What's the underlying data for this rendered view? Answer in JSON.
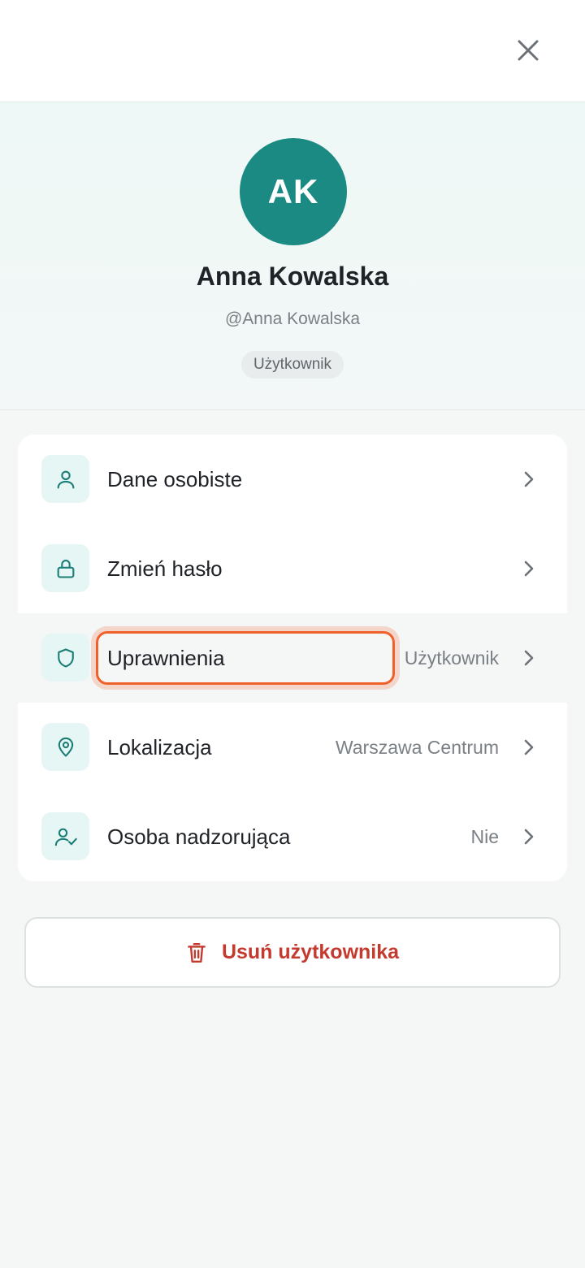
{
  "header": {
    "close_icon": "close-icon"
  },
  "profile": {
    "initials": "AK",
    "name": "Anna Kowalska",
    "username": "@Anna Kowalska",
    "role_badge": "Użytkownik",
    "avatar_color": "#1a8a82"
  },
  "menu": {
    "items": [
      {
        "icon": "user-icon",
        "label": "Dane osobiste",
        "value": ""
      },
      {
        "icon": "lock-icon",
        "label": "Zmień hasło",
        "value": ""
      },
      {
        "icon": "shield-icon",
        "label": "Uprawnienia",
        "value": "Użytkownik",
        "focused": true
      },
      {
        "icon": "map-pin-icon",
        "label": "Lokalizacja",
        "value": "Warszawa Centrum"
      },
      {
        "icon": "user-check-icon",
        "label": "Osoba nadzorująca",
        "value": "Nie"
      }
    ]
  },
  "actions": {
    "delete_label": "Usuń użytkownika",
    "delete_icon": "trash-icon",
    "danger_color": "#c43a2f"
  },
  "colors": {
    "accent": "#1a8a82",
    "icon_bg": "#e6f6f4",
    "focus": "#f0602a"
  }
}
